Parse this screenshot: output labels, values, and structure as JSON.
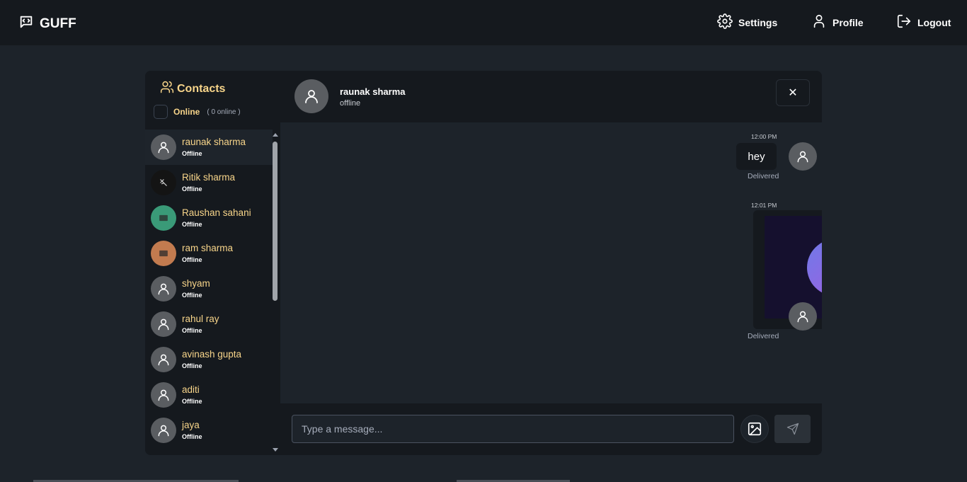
{
  "navbar": {
    "brand": "GUFF",
    "links": [
      {
        "label": "Settings",
        "icon": "gear-icon"
      },
      {
        "label": "Profile",
        "icon": "user-icon"
      },
      {
        "label": "Logout",
        "icon": "logout-icon"
      }
    ]
  },
  "sidebar": {
    "title": "Contacts",
    "online_label": "Online",
    "online_count": "( 0 online )",
    "contacts": [
      {
        "name": "raunak sharma",
        "status": "Offline",
        "avatar": "default"
      },
      {
        "name": "Ritik sharma",
        "status": "Offline",
        "avatar": "photo-dark"
      },
      {
        "name": "Raushan sahani",
        "status": "Offline",
        "avatar": "photo-green"
      },
      {
        "name": "ram sharma",
        "status": "Offline",
        "avatar": "photo-orange"
      },
      {
        "name": "shyam",
        "status": "Offline",
        "avatar": "default"
      },
      {
        "name": "rahul ray",
        "status": "Offline",
        "avatar": "default"
      },
      {
        "name": "avinash gupta",
        "status": "Offline",
        "avatar": "default"
      },
      {
        "name": "aditi",
        "status": "Offline",
        "avatar": "default"
      },
      {
        "name": "jaya",
        "status": "Offline",
        "avatar": "default"
      }
    ]
  },
  "chat": {
    "name": "raunak sharma",
    "status": "offline",
    "close_label": "✕",
    "messages": [
      {
        "time": "12:00 PM",
        "text": "hey",
        "receipt": "Delivered"
      },
      {
        "time": "12:01 PM",
        "image": "satellite-image",
        "receipt": "Delivered"
      }
    ],
    "input_placeholder": "Type a message..."
  },
  "colors": {
    "accent": "#f8d58a",
    "background": "#1d232a",
    "panel": "#15191e"
  }
}
